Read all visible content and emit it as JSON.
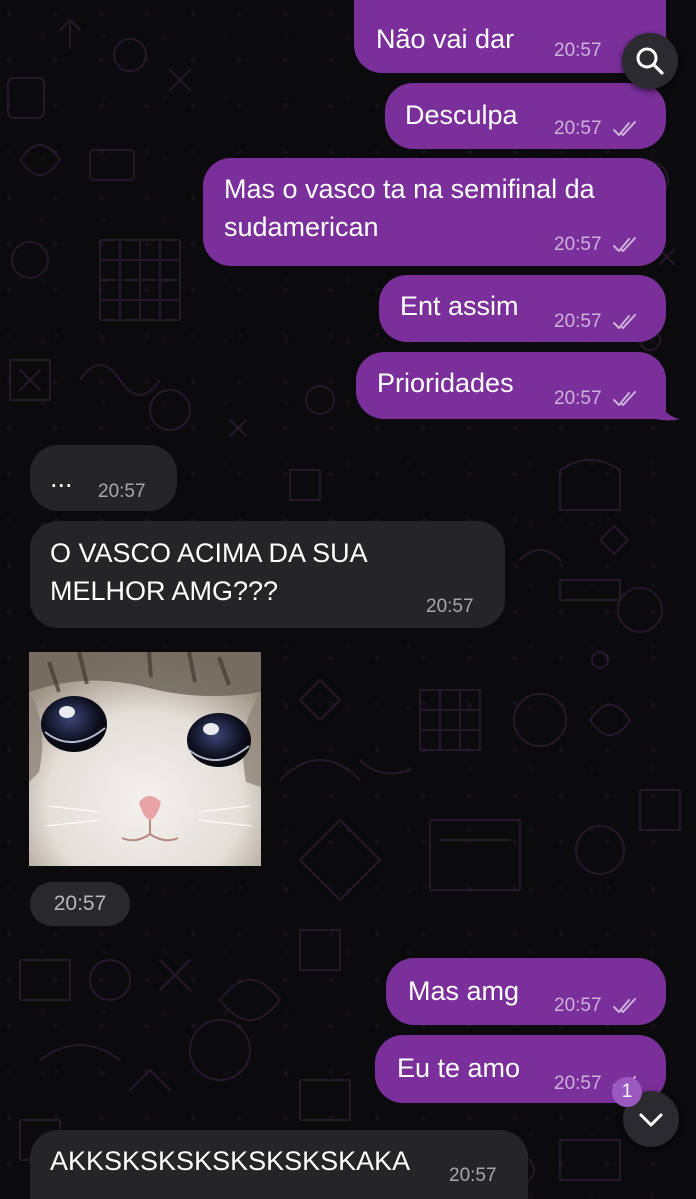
{
  "messages": [
    {
      "dir": "out",
      "text": "Não vai dar",
      "time": "20:57",
      "status_icon": "double-check-icon"
    },
    {
      "dir": "out",
      "text": "Desculpa",
      "time": "20:57",
      "status_icon": "double-check-icon"
    },
    {
      "dir": "out",
      "text": "Mas o vasco ta na semifinal da sudamerican",
      "time": "20:57",
      "status_icon": "double-check-icon"
    },
    {
      "dir": "out",
      "text": "Ent assim",
      "time": "20:57",
      "status_icon": "double-check-icon"
    },
    {
      "dir": "out",
      "text": "Prioridades",
      "time": "20:57",
      "status_icon": "double-check-icon"
    },
    {
      "dir": "in",
      "text": "...",
      "time": "20:57"
    },
    {
      "dir": "in",
      "text": "O VASCO ACIMA DA SUA MELHOR AMG???",
      "time": "20:57"
    },
    {
      "dir": "in",
      "type": "image",
      "image": "crying-cat-sticker",
      "time": "20:57"
    },
    {
      "dir": "out",
      "text": "Mas amg",
      "time": "20:57",
      "status_icon": "double-check-icon"
    },
    {
      "dir": "out",
      "text": "Eu te amo",
      "time": "20:57",
      "status_icon": "double-check-icon"
    },
    {
      "dir": "in",
      "text": "AKKSKSKSKSKSKSKSKAKA",
      "time": "20:57"
    }
  ],
  "controls": {
    "search_icon": "search-icon",
    "scroll_down_icon": "chevron-down-icon",
    "unread_badge": "1"
  },
  "colors": {
    "background": "#0b0a0d",
    "outgoing_bubble": "#7a2f9a",
    "incoming_bubble": "#252427",
    "badge": "#9b59c0"
  }
}
